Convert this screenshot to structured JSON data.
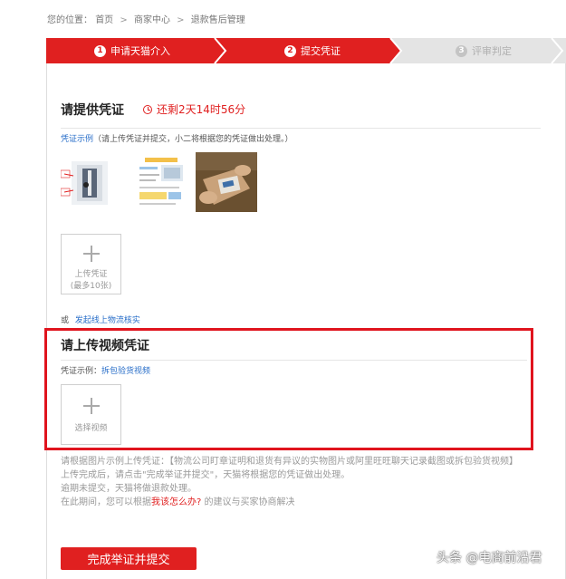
{
  "breadcrumb": {
    "prefix": "您的位置：",
    "items": [
      "首页",
      "商家中心",
      "退款售后管理"
    ],
    "sep": ">"
  },
  "steps": [
    {
      "num": "1",
      "label": "申请天猫介入",
      "state": "active"
    },
    {
      "num": "2",
      "label": "提交凭证",
      "state": "active"
    },
    {
      "num": "3",
      "label": "评审判定",
      "state": "inactive"
    }
  ],
  "evidence": {
    "title": "请提供凭证",
    "timer": "还剩2天14时56分",
    "example_link": "凭证示例",
    "example_note": "（请上传凭证并提交，小二将根据您的凭证做出处理。）",
    "upload_label": "上传凭证",
    "upload_limit": "(最多10张)",
    "or_text": "或",
    "logistics_link": "发起线上物流核实"
  },
  "video": {
    "title": "请上传视频凭证",
    "example_prefix": "凭证示例：",
    "example_link": "拆包验货视频",
    "upload_label": "选择视频"
  },
  "notes": {
    "line1": "请根据图片示例上传凭证：【物流公司盯章证明和退货有异议的实物图片或阿里旺旺聊天记录截图或拆包验货视频】",
    "line2": "上传完成后，请点击\"完成举证并提交\"，天猫将根据您的凭证做出处理。",
    "line3": "逾期未提交，天猫将做退款处理。",
    "line4_before": "在此期间，您可以根据",
    "line4_link": "我该怎么办?",
    "line4_after": " 的建议与买家协商解决"
  },
  "submit_label": "完成举证并提交",
  "watermark": "头条 @电商前沿君",
  "colors": {
    "accent": "#e02020",
    "link": "#2a6fc9",
    "highlight_box": "#e0141e"
  }
}
